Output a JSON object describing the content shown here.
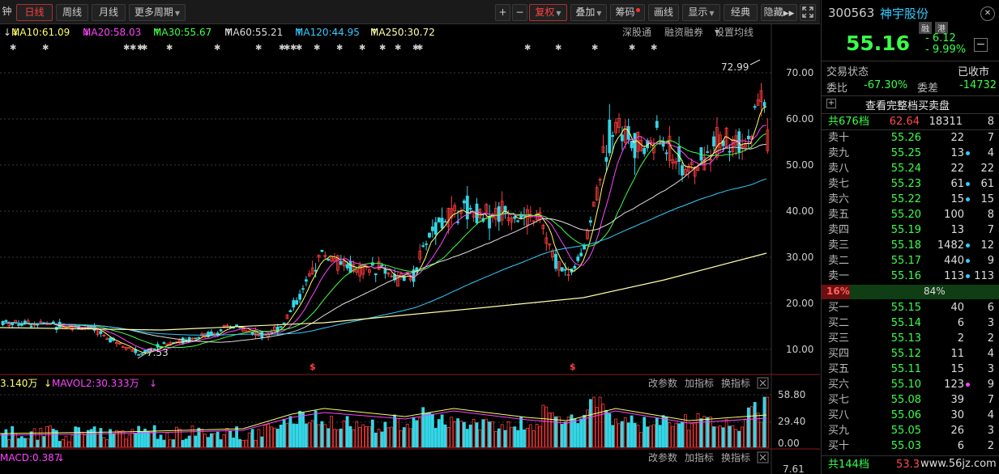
{
  "toolbar": {
    "cut_label": "钟",
    "periods": [
      "日线",
      "周线",
      "月线"
    ],
    "more_periods": "更多周期",
    "zoom_in": "+",
    "zoom_out": "−",
    "fuquan": "复权",
    "overlay": "叠加",
    "chips": "筹码",
    "draw": "画线",
    "display": "显示",
    "classic": "经典",
    "hide": "隐藏",
    "fullscreen_icon": "expand-icon"
  },
  "ma": {
    "ma10": "MA10:61.09",
    "ma20": "MA20:58.03",
    "ma30": "MA30:55.67",
    "ma60": "MA60:55.21",
    "ma120": "MA120:44.95",
    "ma250": "MA250:30.72",
    "shenguton": "深股通",
    "margin": "融资融券",
    "set_ma": "设置均线",
    "colors": {
      "ma10": "#ffff66",
      "ma20": "#ff44ff",
      "ma30": "#44ff44",
      "ma60": "#dddddd",
      "ma120": "#33ccff",
      "ma250": "#ffffaa"
    }
  },
  "price_axis": [
    "70.00",
    "60.00",
    "50.00",
    "40.00",
    "30.00",
    "20.00",
    "10.00"
  ],
  "chart_annotations": {
    "high": "72.99",
    "low": "7.53",
    "signal": "$"
  },
  "volume": {
    "vol_label": "3.140万",
    "mavol2": "MAVOL2:30.333万",
    "change_param": "改参数",
    "add_indicator": "加指标",
    "switch_indicator": "换指标",
    "axis": [
      "58.80",
      "29.40",
      "0.00"
    ],
    "close_icon": "close-icon"
  },
  "macd": {
    "label": "MACD:0.387",
    "change_param": "改参数",
    "add_indicator": "加指标",
    "switch_indicator": "换指标",
    "axis_val": "7.61"
  },
  "stock": {
    "code": "300563",
    "name": "神宇股份",
    "tag1": "融",
    "tag2": "港",
    "price": "55.16",
    "change": "6.12",
    "pct": "9.99%",
    "status_label": "交易状态",
    "status": "已收市",
    "weibi_label": "委比",
    "weibi": "-67.30%",
    "weicha_label": "委差",
    "weicha": "-14732",
    "view_full": "查看完整档买卖盘",
    "total_sell_levels": "共676档",
    "sell_total_price": "62.64",
    "sell_total_vol": "18311",
    "sell_total_cnt": "8",
    "ratio_sell": "16%",
    "ratio_buy": "84%",
    "total_buy_levels": "共144档",
    "buy_total_price": "53.3"
  },
  "sells": [
    {
      "name": "卖十",
      "price": "55.26",
      "vol": "22",
      "dot": "",
      "cnt": "7"
    },
    {
      "name": "卖九",
      "price": "55.25",
      "vol": "13",
      "dot": "#33ccff",
      "cnt": "4"
    },
    {
      "name": "卖八",
      "price": "55.24",
      "vol": "22",
      "dot": "",
      "cnt": "22"
    },
    {
      "name": "卖七",
      "price": "55.23",
      "vol": "61",
      "dot": "#33ccff",
      "cnt": "61"
    },
    {
      "name": "卖六",
      "price": "55.22",
      "vol": "15",
      "dot": "#33ccff",
      "cnt": "15"
    },
    {
      "name": "卖五",
      "price": "55.20",
      "vol": "100",
      "dot": "",
      "cnt": "8"
    },
    {
      "name": "卖四",
      "price": "55.19",
      "vol": "13",
      "dot": "",
      "cnt": "7"
    },
    {
      "name": "卖三",
      "price": "55.18",
      "vol": "1482",
      "dot": "#33ccff",
      "cnt": "12"
    },
    {
      "name": "卖二",
      "price": "55.17",
      "vol": "440",
      "dot": "#33ccff",
      "cnt": "9"
    },
    {
      "name": "卖一",
      "price": "55.16",
      "vol": "113",
      "dot": "#33ccff",
      "cnt": "113"
    }
  ],
  "buys": [
    {
      "name": "买一",
      "price": "55.15",
      "vol": "40",
      "dot": "",
      "cnt": "6"
    },
    {
      "name": "买二",
      "price": "55.14",
      "vol": "6",
      "dot": "",
      "cnt": "3"
    },
    {
      "name": "买三",
      "price": "55.13",
      "vol": "2",
      "dot": "",
      "cnt": "2"
    },
    {
      "name": "买四",
      "price": "55.12",
      "vol": "11",
      "dot": "",
      "cnt": "4"
    },
    {
      "name": "买五",
      "price": "55.11",
      "vol": "15",
      "dot": "",
      "cnt": "3"
    },
    {
      "name": "买六",
      "price": "55.10",
      "vol": "123",
      "dot": "#ff44ff",
      "cnt": "9"
    },
    {
      "name": "买七",
      "price": "55.08",
      "vol": "39",
      "dot": "",
      "cnt": "7"
    },
    {
      "name": "买八",
      "price": "55.06",
      "vol": "30",
      "dot": "",
      "cnt": "4"
    },
    {
      "name": "买九",
      "price": "55.05",
      "vol": "26",
      "dot": "",
      "cnt": "3"
    },
    {
      "name": "买十",
      "price": "55.03",
      "vol": "6",
      "dot": "",
      "cnt": "2"
    }
  ],
  "watermark": "www.56jz.com"
}
